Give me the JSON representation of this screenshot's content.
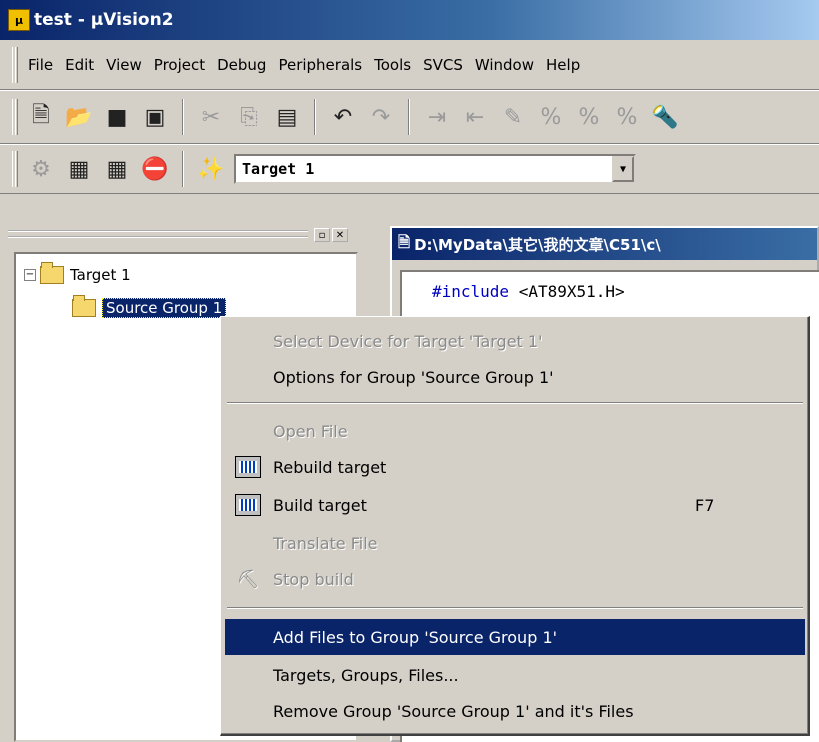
{
  "window": {
    "title": "test  - µVision2",
    "app_icon": "uv-app-icon"
  },
  "menubar": [
    {
      "label": "File",
      "u": "F"
    },
    {
      "label": "Edit",
      "u": "E"
    },
    {
      "label": "View",
      "u": "V"
    },
    {
      "label": "Project",
      "u": "P"
    },
    {
      "label": "Debug",
      "u": "D"
    },
    {
      "label": "Peripherals",
      "u": "r"
    },
    {
      "label": "Tools",
      "u": "T"
    },
    {
      "label": "SVCS",
      "u": "S"
    },
    {
      "label": "Window",
      "u": "W"
    },
    {
      "label": "Help",
      "u": "H"
    }
  ],
  "toolbar": {
    "target_combo_value": "Target 1",
    "icons": [
      "new-file-icon",
      "open-folder-icon",
      "save-icon",
      "save-all-icon",
      "cut-icon",
      "copy-icon",
      "paste-icon",
      "undo-icon",
      "redo-icon",
      "indent-icon",
      "outdent-icon",
      "bookmark-icon",
      "find-icon"
    ]
  },
  "project_tree": {
    "root": "Target 1",
    "group": "Source Group 1"
  },
  "editor": {
    "title": "D:\\MyData\\其它\\我的文章\\C51\\c\\",
    "line1_kw": "#include",
    "line1_rest": " <AT89X51.H>"
  },
  "context_menu": {
    "items": [
      {
        "label": "Select Device for Target 'Target 1'",
        "disabled": true,
        "icon": null,
        "key": ""
      },
      {
        "label": "Options for Group 'Source Group 1'",
        "disabled": false,
        "icon": null,
        "key": ""
      },
      {
        "separator": true
      },
      {
        "label": "Open File",
        "disabled": true,
        "icon": null,
        "key": ""
      },
      {
        "label": "Rebuild target",
        "disabled": false,
        "icon": "rebuild-icon",
        "key": ""
      },
      {
        "label": "Build target",
        "disabled": false,
        "icon": "build-icon",
        "key": "F7"
      },
      {
        "label": "Translate File",
        "disabled": true,
        "icon": null,
        "key": ""
      },
      {
        "label": "Stop build",
        "disabled": true,
        "icon": "stop-build-icon",
        "key": ""
      },
      {
        "separator": true
      },
      {
        "label": "Add Files to Group 'Source Group 1'",
        "disabled": false,
        "icon": null,
        "key": "",
        "highlighted": true
      },
      {
        "label": "Targets, Groups, Files...",
        "disabled": false,
        "icon": null,
        "key": ""
      },
      {
        "label": "Remove Group 'Source Group 1' and it's Files",
        "disabled": false,
        "icon": null,
        "key": ""
      }
    ]
  },
  "colors": {
    "selection": "#0a246a",
    "face": "#d4d0c8",
    "code_keyword": "#0000c0"
  }
}
